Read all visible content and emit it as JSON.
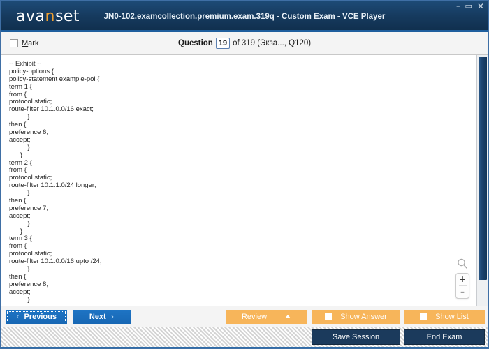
{
  "window": {
    "title": "JN0-102.examcollection.premium.exam.319q - Custom Exam - VCE Player",
    "logo_main_1": "ava",
    "logo_accent": "n",
    "logo_main_2": "set",
    "minimize_icon": "–",
    "maximize_icon": "▭",
    "close_icon": "✕"
  },
  "question_header": {
    "mark_label_accel": "M",
    "mark_label_rest": "ark",
    "question_label": "Question",
    "question_number": "19",
    "question_rest": "of 319 (Экза..., Q120)"
  },
  "exhibit": {
    "lines": [
      "-- Exhibit --",
      "policy-options {",
      "policy-statement example-pol {",
      "term 1 {",
      "from {",
      "protocol static;",
      "route-filter 10.1.0.0/16 exact;",
      "          }",
      "then {",
      "preference 6;",
      "accept;",
      "          }",
      "      }",
      "term 2 {",
      "from {",
      "protocol static;",
      "route-filter 10.1.1.0/24 longer;",
      "          }",
      "then {",
      "preference 7;",
      "accept;",
      "          }",
      "      }",
      "term 3 {",
      "from {",
      "protocol static;",
      "route-filter 10.1.0.0/16 upto /24;",
      "          }",
      "then {",
      "preference 8;",
      "accept;",
      "          }"
    ]
  },
  "zoom_tools": {
    "magnifier_icon": "search-icon",
    "zoom_in": "+",
    "zoom_out": "–"
  },
  "action_bar": {
    "previous_label": "Previous",
    "previous_chevron": "‹",
    "next_label": "Next",
    "next_chevron": "›",
    "review_label": "Review",
    "show_answer_label": "Show Answer",
    "show_list_label": "Show List"
  },
  "status_bar": {
    "save_session_label": "Save Session",
    "end_exam_label": "End Exam"
  },
  "colors": {
    "titlebar_dark": "#163a5e",
    "accent_blue": "#1f5f9e",
    "logo_orange": "#f0a030",
    "button_blue": "#1767b4",
    "button_orange": "#f7b55a",
    "button_navy": "#1b3a5c"
  }
}
